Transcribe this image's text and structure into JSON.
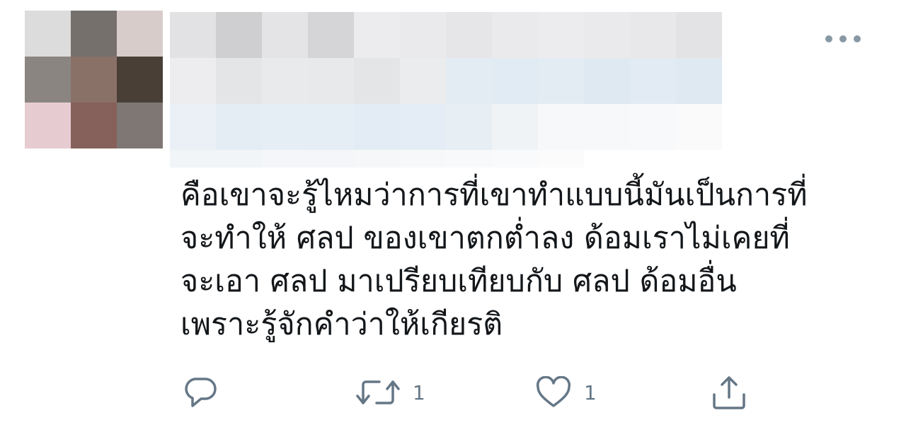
{
  "tweet": {
    "text_lines": [
      "คือเขาจะรู้ไหมว่าการที่เขาทำแบบนี้มันเป็นการที่",
      "จะทำให้ ศลป ของเขาตกต่ำลง ด้อมเราไม่เคยที่",
      "จะเอา ศลป มาเปรียบเทียบกับ ศลป ด้อมอื่น",
      "เพราะรู้จักคำว่าให้เกียรติ"
    ],
    "text_color": "#14171a"
  },
  "avatar": {
    "pixelated": true,
    "colors": [
      "#dcdcdc",
      "#75706b",
      "#d8ccca",
      "#8b8581",
      "#8a7168",
      "#4a3f37",
      "#e6ccd1",
      "#86605a",
      "#7e7774"
    ]
  },
  "header": {
    "pixelated": true,
    "rows": [
      [
        "#e2e2e4",
        "#cfcfd1",
        "#e4e4e6",
        "#d5d5d7",
        "#ececee",
        "#eaeaec",
        "#e6e6e8",
        "#eaeaec",
        "#ececee",
        "#eaeaec",
        "#e8e8ea",
        "#e3e3e5"
      ],
      [
        "#ededef",
        "#e4e5e7",
        "#e9eaec",
        "#e8e9eb",
        "#e4e5e7",
        "#ebecee",
        "#e3ecf3",
        "#e1ebf3",
        "#e4ecf3",
        "#dfe9f2",
        "#e2ebf3",
        "#dfe9f2"
      ],
      [
        "#eaf0f6",
        "#e5edf4",
        "#e6eef5",
        "#e5eef5",
        "#e3ecf4",
        "#e4edf5",
        "#e7eef4",
        "#eff3f6",
        "#f6f8fa",
        "#f7f8fa",
        "#f8f9fa",
        "#fafafb"
      ],
      [
        "#f2f5f8",
        "#f2f5f8",
        "#f4f6f9",
        "#f4f6f9",
        "#f5f7f9",
        "#f6f8fa",
        "#f8f9fb",
        "#f9fafb",
        "#fbfbfc",
        "#ffffff",
        "#ffffff",
        "#ffffff"
      ]
    ]
  },
  "actions": {
    "reply": {
      "icon": "reply-icon",
      "count": ""
    },
    "retweet": {
      "icon": "retweet-icon",
      "count": "1"
    },
    "like": {
      "icon": "heart-icon",
      "count": "1"
    },
    "share": {
      "icon": "share-icon",
      "count": ""
    },
    "icon_color": "#657786"
  },
  "more": {
    "icon": "more-icon"
  }
}
